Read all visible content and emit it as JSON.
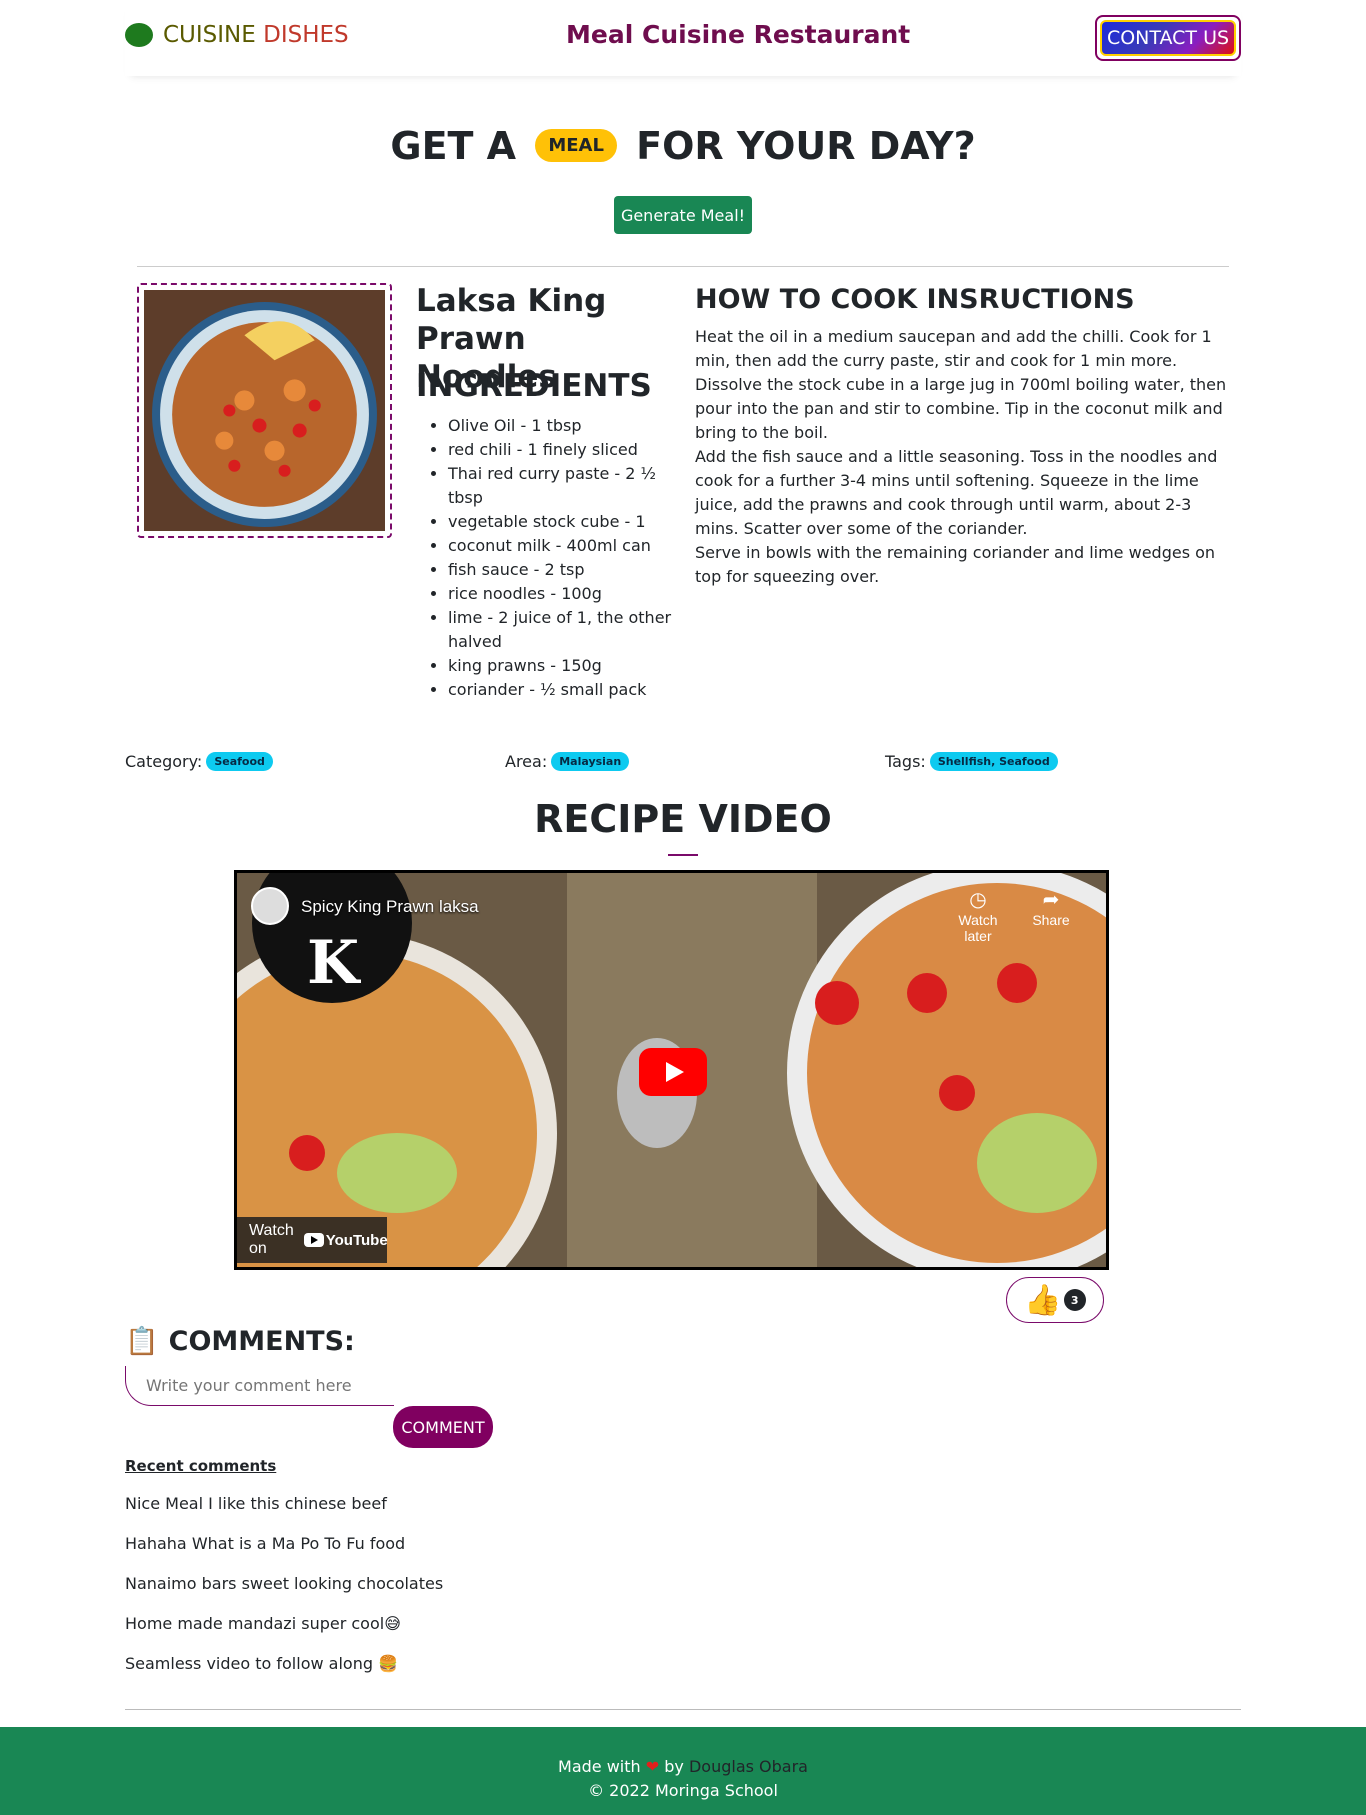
{
  "navbar": {
    "brand_word1": "CUISINE",
    "brand_word2": "DISHES",
    "site_title": "Meal Cuisine Restaurant",
    "contact_label": "CONTACT US"
  },
  "hero": {
    "title_before": "GET A",
    "title_pill": "MEAL",
    "title_after": "FOR YOUR DAY?",
    "generate_label": "Generate Meal!"
  },
  "meal": {
    "name": "Laksa King Prawn Noodles",
    "ingredients_title": "INGREDIENTS",
    "ingredients": [
      "Olive Oil - 1 tbsp",
      "red chili - 1 finely sliced",
      "Thai red curry paste - 2 ½ tbsp",
      "vegetable stock cube - 1",
      "coconut milk - 400ml can",
      "fish sauce - 2 tsp",
      "rice noodles - 100g",
      "lime - 2 juice of 1, the other halved",
      "king prawns - 150g",
      "coriander - ½ small pack"
    ],
    "howto_title": "HOW TO COOK INSRUCTIONS",
    "howto": [
      "Heat the oil in a medium saucepan and add the chilli. Cook for 1 min, then add the curry paste, stir and cook for 1 min more. Dissolve the stock cube in a large jug in 700ml boiling water, then pour into the pan and stir to combine. Tip in the coconut milk and bring to the boil.",
      "Add the fish sauce and a little seasoning. Toss in the noodles and cook for a further 3-4 mins until softening. Squeeze in the lime juice, add the prawns and cook through until warm, about 2-3 mins. Scatter over some of the coriander.",
      "Serve in bowls with the remaining coriander and lime wedges on top for squeezing over."
    ]
  },
  "tags": {
    "category_label": "Category:",
    "category": "Seafood",
    "area_label": "Area:",
    "area": "Malaysian",
    "tags_label": "Tags:",
    "tags": "Shellfish, Seafood"
  },
  "video": {
    "section_title": "RECIPE VIDEO",
    "title": "Spicy King Prawn laksa",
    "watch_later": "Watch later",
    "share": "Share",
    "watch_on": "Watch on",
    "youtube": "YouTube"
  },
  "likes": {
    "count": "3",
    "icon": "thumbs-up-emoji"
  },
  "comments": {
    "title": "COMMENTS:",
    "placeholder": "Write your comment here",
    "button_label": "COMMENT",
    "recent_title": "Recent comments",
    "recent": [
      "Nice Meal I like this chinese beef",
      "Hahaha What is a Ma Po To Fu food",
      "Nanaimo bars sweet looking chocolates",
      "Home made mandazi super cool😅",
      "Seamless video to follow along 🍔"
    ]
  },
  "footer": {
    "made_with": "Made with",
    "by": "by",
    "author": "Douglas Obara",
    "copyright": "© 2022 Moringa School"
  },
  "colors": {
    "accent": "#800060",
    "green": "#198754",
    "yellow": "#ffc107",
    "cyan": "#0dcaf0"
  }
}
